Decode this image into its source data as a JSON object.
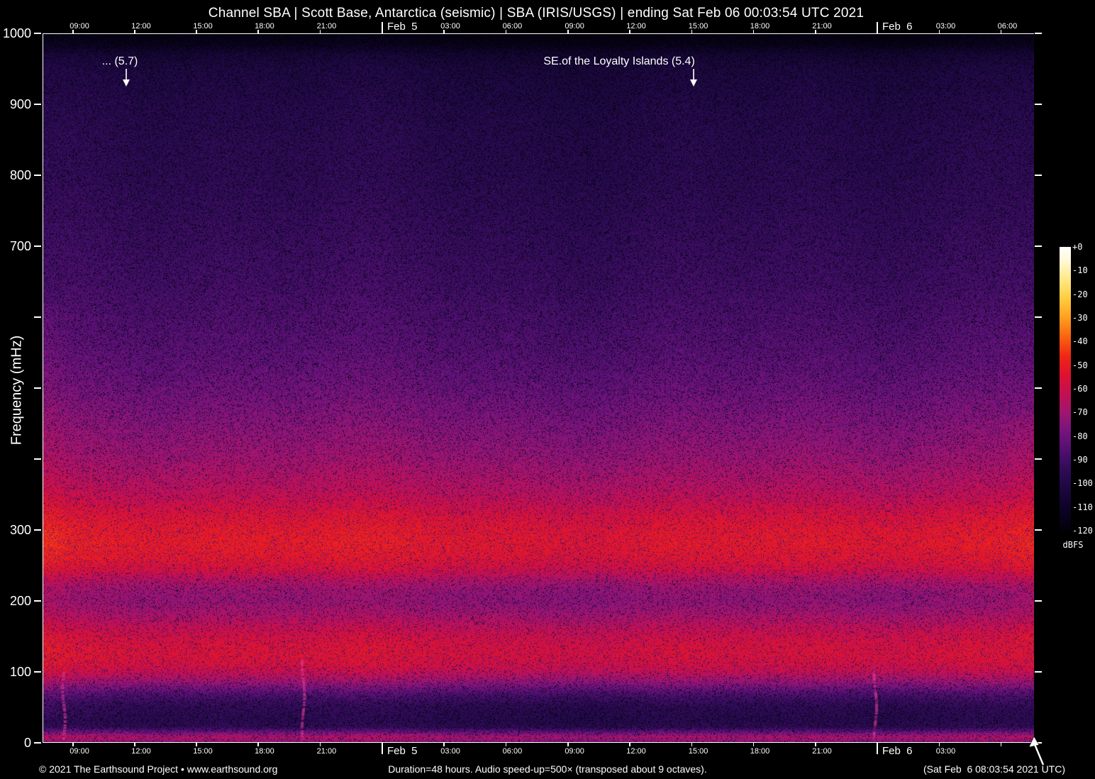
{
  "title": "Channel SBA | Scott Base, Antarctica (seismic) | SBA (IRIS/USGS) | ending Sat Feb 06 00:03:54 UTC 2021",
  "axes": {
    "ylabel": "Frequency (mHz)",
    "x_ticks": [
      {
        "label": "09:00",
        "frac": 0.0308,
        "kind": "time",
        "on_bottom": true
      },
      {
        "label": "12:00",
        "frac": 0.093,
        "kind": "time",
        "on_bottom": true
      },
      {
        "label": "15:00",
        "frac": 0.1552,
        "kind": "time",
        "on_bottom": true
      },
      {
        "label": "18:00",
        "frac": 0.2174,
        "kind": "time",
        "on_bottom": true
      },
      {
        "label": "21:00",
        "frac": 0.28,
        "kind": "time",
        "on_bottom": true
      },
      {
        "label": "Feb  5",
        "frac": 0.3426,
        "kind": "date",
        "on_bottom": true
      },
      {
        "label": "03:00",
        "frac": 0.4049,
        "kind": "time",
        "on_bottom": true
      },
      {
        "label": "06:00",
        "frac": 0.4674,
        "kind": "time",
        "on_bottom": true
      },
      {
        "label": "09:00",
        "frac": 0.5301,
        "kind": "time",
        "on_bottom": true
      },
      {
        "label": "12:00",
        "frac": 0.5923,
        "kind": "time",
        "on_bottom": true
      },
      {
        "label": "15:00",
        "frac": 0.6549,
        "kind": "time",
        "on_bottom": true
      },
      {
        "label": "18:00",
        "frac": 0.7171,
        "kind": "time",
        "on_bottom": true
      },
      {
        "label": "21:00",
        "frac": 0.7797,
        "kind": "time",
        "on_bottom": true
      },
      {
        "label": "Feb  6",
        "frac": 0.8419,
        "kind": "date",
        "on_bottom": true
      },
      {
        "label": "03:00",
        "frac": 0.9045,
        "kind": "time",
        "on_bottom": true
      },
      {
        "label": "06:00",
        "frac": 0.9667,
        "kind": "time",
        "on_bottom": false
      }
    ],
    "y_ticks": [
      {
        "label": "1000",
        "frac": 0.0
      },
      {
        "label": "900",
        "frac": 0.1
      },
      {
        "label": "800",
        "frac": 0.2
      },
      {
        "label": "700",
        "frac": 0.3
      },
      {
        "label": "",
        "frac": 0.4
      },
      {
        "label": "",
        "frac": 0.5
      },
      {
        "label": "",
        "frac": 0.6
      },
      {
        "label": "300",
        "frac": 0.7
      },
      {
        "label": "200",
        "frac": 0.8
      },
      {
        "label": "100",
        "frac": 0.9
      },
      {
        "label": "0",
        "frac": 1.0
      }
    ]
  },
  "annotations": [
    {
      "text": "... (5.7)",
      "magnitude": 5.7,
      "text_center_frac": 0.078,
      "arrow_frac": 0.0844
    },
    {
      "text": "SE.of the Loyalty Islands (5.4)",
      "magnitude": 5.4,
      "text_center_frac": 0.5816,
      "arrow_frac": 0.6567
    }
  ],
  "colorbar": {
    "tick_labels": [
      "+0",
      "-10",
      "-20",
      "-30",
      "-40",
      "-50",
      "-60",
      "-70",
      "-80",
      "-90",
      "-100",
      "-110",
      "-120"
    ],
    "unit": "dBFS"
  },
  "footer": {
    "left": "© 2021 The Earthsound Project • www.earthsound.org",
    "center": "Duration=48 hours. Audio speed-up=500× (transposed about 9 octaves).",
    "right": "(Sat Feb  6 08:03:54 2021 UTC)"
  },
  "chart_data": {
    "type": "heatmap",
    "subtype": "audio-spectrogram",
    "title": "Channel SBA | Scott Base, Antarctica (seismic) | SBA (IRIS/USGS) | ending Sat Feb 06 00:03:54 UTC 2021",
    "station": "SBA (IRIS/USGS), Scott Base, Antarctica (seismic)",
    "duration_hours": 48,
    "x_tick_labels": [
      "09:00",
      "12:00",
      "15:00",
      "18:00",
      "21:00",
      "Feb 5",
      "03:00",
      "06:00",
      "09:00",
      "12:00",
      "15:00",
      "18:00",
      "21:00",
      "Feb 6",
      "03:00",
      "06:00"
    ],
    "ylabel": "Frequency (mHz)",
    "ylim": [
      0,
      1000
    ],
    "y_tick_labels_visible": [
      1000,
      900,
      800,
      700,
      300,
      200,
      100,
      0
    ],
    "z_unit": "dBFS",
    "zlim": [
      -120,
      0
    ],
    "colorbar_ticks": [
      0,
      -10,
      -20,
      -30,
      -40,
      -50,
      -60,
      -70,
      -80,
      -90,
      -100,
      -110,
      -120
    ],
    "legend_position": "right-colorbar",
    "grid": false,
    "events": [
      {
        "label": "... (5.7)",
        "magnitude": 5.7,
        "x_frac": 0.0844
      },
      {
        "label": "SE.of the Loyalty Islands (5.4)",
        "magnitude": 5.4,
        "x_frac": 0.6567
      }
    ],
    "frequency_profile": [
      {
        "mHz": 1000,
        "dBFS": -119
      },
      {
        "mHz": 985,
        "dBFS": -115
      },
      {
        "mHz": 970,
        "dBFS": -106
      },
      {
        "mHz": 950,
        "dBFS": -102
      },
      {
        "mHz": 900,
        "dBFS": -99
      },
      {
        "mHz": 850,
        "dBFS": -97
      },
      {
        "mHz": 800,
        "dBFS": -96
      },
      {
        "mHz": 750,
        "dBFS": -94
      },
      {
        "mHz": 700,
        "dBFS": -92
      },
      {
        "mHz": 650,
        "dBFS": -90
      },
      {
        "mHz": 600,
        "dBFS": -87
      },
      {
        "mHz": 550,
        "dBFS": -84
      },
      {
        "mHz": 500,
        "dBFS": -80
      },
      {
        "mHz": 450,
        "dBFS": -75
      },
      {
        "mHz": 400,
        "dBFS": -70
      },
      {
        "mHz": 360,
        "dBFS": -64
      },
      {
        "mHz": 340,
        "dBFS": -60
      },
      {
        "mHz": 320,
        "dBFS": -55
      },
      {
        "mHz": 300,
        "dBFS": -52
      },
      {
        "mHz": 280,
        "dBFS": -51
      },
      {
        "mHz": 260,
        "dBFS": -53
      },
      {
        "mHz": 245,
        "dBFS": -57
      },
      {
        "mHz": 230,
        "dBFS": -65
      },
      {
        "mHz": 215,
        "dBFS": -71
      },
      {
        "mHz": 200,
        "dBFS": -72
      },
      {
        "mHz": 185,
        "dBFS": -69
      },
      {
        "mHz": 170,
        "dBFS": -64
      },
      {
        "mHz": 155,
        "dBFS": -59
      },
      {
        "mHz": 140,
        "dBFS": -56
      },
      {
        "mHz": 125,
        "dBFS": -55
      },
      {
        "mHz": 110,
        "dBFS": -57
      },
      {
        "mHz": 100,
        "dBFS": -61
      },
      {
        "mHz": 90,
        "dBFS": -68
      },
      {
        "mHz": 80,
        "dBFS": -76
      },
      {
        "mHz": 70,
        "dBFS": -85
      },
      {
        "mHz": 60,
        "dBFS": -91
      },
      {
        "mHz": 50,
        "dBFS": -95
      },
      {
        "mHz": 40,
        "dBFS": -96
      },
      {
        "mHz": 30,
        "dBFS": -97
      },
      {
        "mHz": 22,
        "dBFS": -95
      },
      {
        "mHz": 15,
        "dBFS": -80
      },
      {
        "mHz": 8,
        "dBFS": -66
      },
      {
        "mHz": 3,
        "dBFS": -72
      },
      {
        "mHz": 0,
        "dBFS": -78
      }
    ],
    "colormap_stops": [
      {
        "db": 0,
        "rgb": [
          255,
          255,
          255
        ]
      },
      {
        "db": -6,
        "rgb": [
          255,
          248,
          214
        ]
      },
      {
        "db": -14,
        "rgb": [
          255,
          232,
          130
        ]
      },
      {
        "db": -22,
        "rgb": [
          255,
          204,
          62
        ]
      },
      {
        "db": -30,
        "rgb": [
          255,
          158,
          32
        ]
      },
      {
        "db": -38,
        "rgb": [
          250,
          100,
          16
        ]
      },
      {
        "db": -46,
        "rgb": [
          240,
          40,
          22
        ]
      },
      {
        "db": -54,
        "rgb": [
          222,
          18,
          48
        ]
      },
      {
        "db": -62,
        "rgb": [
          196,
          16,
          84
        ]
      },
      {
        "db": -70,
        "rgb": [
          160,
          22,
          112
        ]
      },
      {
        "db": -78,
        "rgb": [
          118,
          20,
          126
        ]
      },
      {
        "db": -86,
        "rgb": [
          80,
          16,
          112
        ]
      },
      {
        "db": -94,
        "rgb": [
          48,
          12,
          88
        ]
      },
      {
        "db": -102,
        "rgb": [
          28,
          8,
          64
        ]
      },
      {
        "db": -110,
        "rgb": [
          14,
          4,
          40
        ]
      },
      {
        "db": -120,
        "rgb": [
          3,
          1,
          10
        ]
      }
    ],
    "noise_streaks": [
      {
        "x_frac": 0.0215,
        "mHz_top": 100
      },
      {
        "x_frac": 0.263,
        "mHz_top": 120
      },
      {
        "x_frac": 0.84,
        "mHz_top": 110
      }
    ]
  }
}
